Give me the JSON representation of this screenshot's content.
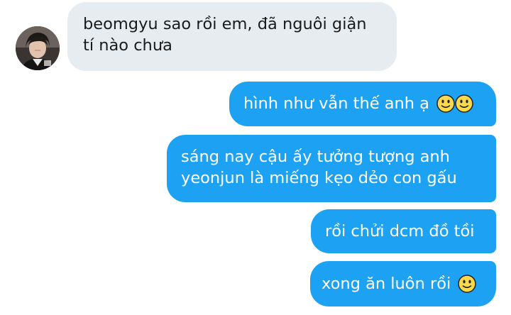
{
  "conversation": {
    "incoming": {
      "lines": [
        "beomgyu sao rồi em, đã nguôi giận",
        "tí nào chưa"
      ]
    },
    "outgoing": [
      {
        "lines": [
          "hình như vẫn thế anh ạ"
        ],
        "emoji": [
          "slightly-smiling-face-emoji",
          "slightly-smiling-face-emoji"
        ]
      },
      {
        "lines": [
          "sáng nay cậu ấy tưởng tượng anh",
          "yeonjun là miếng kẹo dẻo con gấu"
        ]
      },
      {
        "lines": [
          "rồi chửi dcm đồ tồi"
        ]
      },
      {
        "lines": [
          "xong ăn luôn rồi"
        ],
        "emoji": [
          "slightly-smiling-face-emoji"
        ]
      }
    ]
  },
  "colors": {
    "outgoing_bubble": "#1da1f2",
    "incoming_bubble": "#e6ecf0",
    "incoming_text": "#1b1b1b",
    "outgoing_text": "#ffffff"
  }
}
